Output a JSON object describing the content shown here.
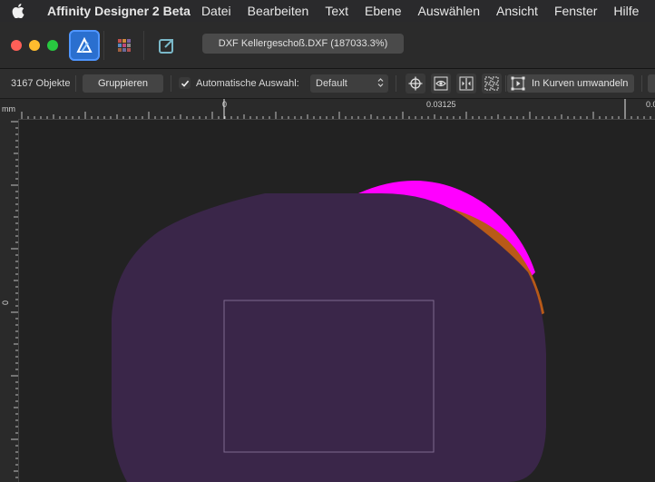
{
  "menubar": {
    "app_name": "Affinity Designer 2 Beta",
    "items": [
      "Datei",
      "Bearbeiten",
      "Text",
      "Ebene",
      "Auswählen",
      "Ansicht",
      "Fenster",
      "Hilfe"
    ]
  },
  "window": {
    "document_tab": "DXF Kellergeschoß.DXF (187033.3%)"
  },
  "toolbar": {
    "object_count": "3167 Objekte",
    "group_label": "Gruppieren",
    "auto_select_label": "Automatische Auswahl:",
    "auto_select_checked": true,
    "auto_select_value": "Default",
    "convert_to_curves_label": "In Kurven umwandeln"
  },
  "ruler": {
    "unit": "mm",
    "top_labels": [
      "0",
      "0.03125",
      "0.0"
    ],
    "left_labels": [
      "0"
    ]
  },
  "colors": {
    "shape_fill": "#3a2649",
    "magenta": "#ff00ff",
    "orange": "#b85a18",
    "accent": "#2a6fcf"
  }
}
